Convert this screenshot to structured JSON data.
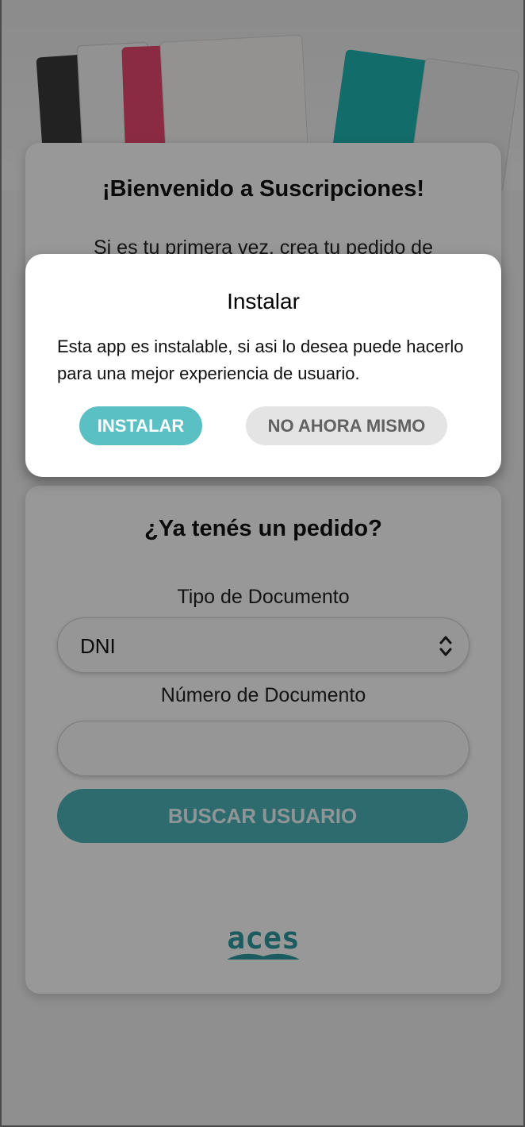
{
  "welcome": {
    "title": "¡Bienvenido a Suscripciones!",
    "text": "Si es tu primera vez, crea tu pedido de"
  },
  "order_lookup": {
    "title": "¿Ya tenés un pedido?",
    "doc_type_label": "Tipo de Documento",
    "doc_type_value": "DNI",
    "doc_number_label": "Número de Documento",
    "doc_number_value": "",
    "search_button": "BUSCAR USUARIO"
  },
  "logo": {
    "text": "aces",
    "color": "#2f9aa0"
  },
  "install_dialog": {
    "title": "Instalar",
    "message": "Esta app es instalable, si asi lo desea puede hacerlo para una mejor experiencia de usuario.",
    "install_button": "INSTALAR",
    "dismiss_button": "NO AHORA MISMO"
  },
  "colors": {
    "accent": "#4db3b8",
    "install_button": "#5bc0c3",
    "secondary_button": "#e4e4e4"
  },
  "icons": {
    "select_chevron": "chevron-up-down-icon"
  }
}
